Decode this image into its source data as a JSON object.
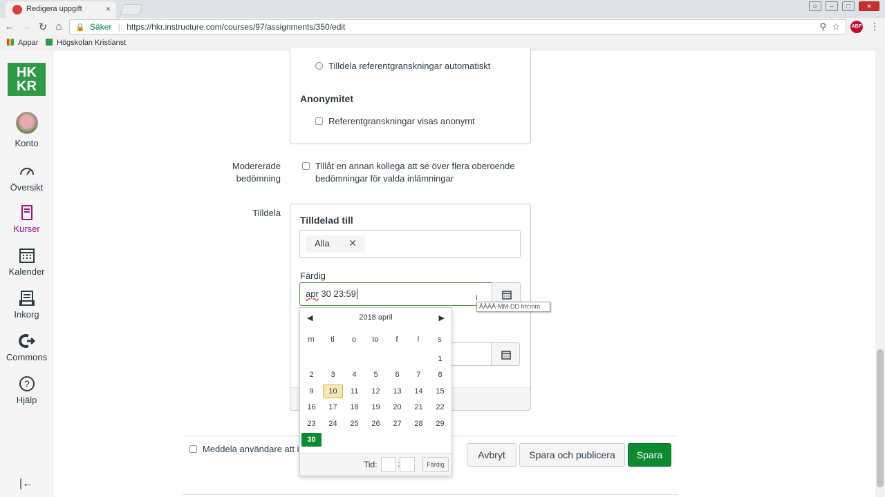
{
  "browser": {
    "tab_title": "Redigera uppgift",
    "tab_close": "×",
    "secure_label": "Säker",
    "url": "https://hkr.instructure.com/courses/97/assignments/350/edit",
    "bookmarks": [
      "Appar",
      "Högskolan Kristianst"
    ]
  },
  "nav": {
    "logo": "HKR",
    "items": [
      {
        "label": "Konto"
      },
      {
        "label": "Översikt"
      },
      {
        "label": "Kurser"
      },
      {
        "label": "Kalender"
      },
      {
        "label": "Inkorg"
      },
      {
        "label": "Commons"
      },
      {
        "label": "Hjälp"
      }
    ],
    "collapse": "|←"
  },
  "peer_review": {
    "auto_label": "Tilldela referentgranskningar automatiskt",
    "anon_heading": "Anonymitet",
    "anon_label": "Referentgranskningar visas anonymt"
  },
  "moderated": {
    "label_line1": "Modererade",
    "label_line2": "bedömning",
    "text_line1": "Tillåt en annan kollega att se över flera oberoende",
    "text_line2": "bedömningar för valda inlämningar"
  },
  "assign": {
    "row_label": "Tilldela",
    "heading": "Tilldelad till",
    "tag": "Alla",
    "tag_remove": "✕",
    "due_label": "Färdig",
    "due_value_a": "apr",
    "due_value_b": " 30 23:59",
    "tooltip": "ÅÅÅÅ-MM-DD hh:mm"
  },
  "datepicker": {
    "month": "2018 april",
    "prev": "◀",
    "next": "▶",
    "weekdays": [
      "m",
      "ti",
      "o",
      "to",
      "f",
      "l",
      "s"
    ],
    "weeks": [
      [
        "",
        "",
        "",
        "",
        "",
        "",
        "1"
      ],
      [
        "2",
        "3",
        "4",
        "5",
        "6",
        "7",
        "8"
      ],
      [
        "9",
        "10",
        "11",
        "12",
        "13",
        "14",
        "15"
      ],
      [
        "16",
        "17",
        "18",
        "19",
        "20",
        "21",
        "22"
      ],
      [
        "23",
        "24",
        "25",
        "26",
        "27",
        "28",
        "29"
      ],
      [
        "30",
        "",
        "",
        "",
        "",
        "",
        ""
      ]
    ],
    "today": "10",
    "selected": "30",
    "time_label": "Tid:",
    "time_sep": ":",
    "done_label": "Färdig"
  },
  "footer": {
    "notify_label": "Meddela användare att in",
    "cancel": "Avbryt",
    "save_publish": "Spara och publicera",
    "save": "Spara"
  },
  "colors": {
    "accent": "#0b8a2f",
    "active_nav": "#a3117d",
    "logo_bg": "#2f9a46"
  }
}
